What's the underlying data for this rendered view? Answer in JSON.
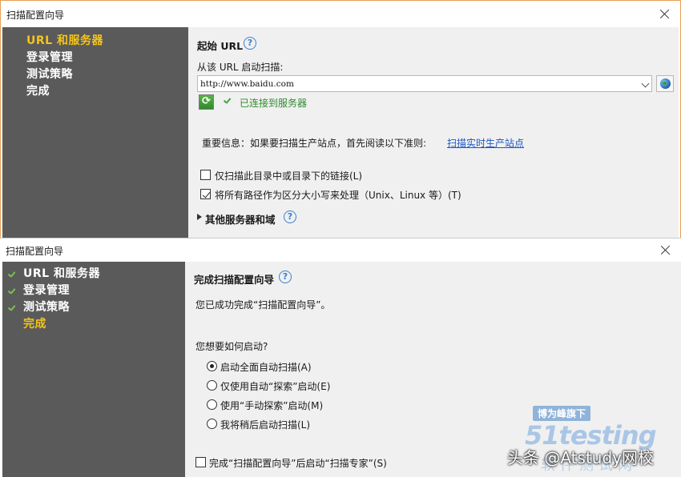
{
  "window1": {
    "title": "扫描配置向导",
    "nav": [
      {
        "label": "URL 和服务器",
        "active": true
      },
      {
        "label": "登录管理",
        "active": false
      },
      {
        "label": "测试策略",
        "active": false
      },
      {
        "label": "完成",
        "active": false
      }
    ],
    "section_title": "起始 URL",
    "help_glyph": "?",
    "field_label": "从该 URL 启动扫描:",
    "url_value": "http://www.baidu.com",
    "refresh_glyph": "⟳",
    "status_text": "已连接到服务器",
    "important_text": "重要信息：如果要扫描生产站点，首先阅读以下准则:",
    "important_link": "扫描实时生产站点",
    "options": [
      {
        "label": "仅扫描此目录中或目录下的链接(L)",
        "checked": false
      },
      {
        "label": "将所有路径作为区分大小写来处理（Unix、Linux 等）(T)",
        "checked": true
      }
    ],
    "expander_label": "其他服务器和域"
  },
  "window2": {
    "title": "扫描配置向导",
    "nav": [
      {
        "label": "URL 和服务器",
        "completed": true,
        "active": false
      },
      {
        "label": "登录管理",
        "completed": true,
        "active": false
      },
      {
        "label": "测试策略",
        "completed": true,
        "active": false
      },
      {
        "label": "完成",
        "completed": false,
        "active": true
      }
    ],
    "section_title": "完成扫描配置向导",
    "help_glyph": "?",
    "done_text": "您已成功完成“扫描配置向导”。",
    "question": "您想要如何启动?",
    "radios": [
      {
        "label": "启动全面自动扫描(A)",
        "checked": true
      },
      {
        "label": "仅使用自动“探索”启动(E)",
        "checked": false
      },
      {
        "label": "使用“手动探索”启动(M)",
        "checked": false
      },
      {
        "label": "我将稍后启动扫描(L)",
        "checked": false
      }
    ],
    "final_checkbox": {
      "label": "完成“扫描配置向导”后启动“扫描专家”(S)",
      "checked": false
    }
  },
  "watermark": {
    "tag": "博为峰旗下",
    "logo": "51testing",
    "sub": "软件测试网",
    "credit": "头条 @Atstudy网校"
  },
  "colors": {
    "sidebar_bg": "#5a5a5a",
    "nav_active": "#f5c518",
    "nav_text": "#ffffff",
    "content_bg": "#f0f0f0",
    "link": "#1c56c4",
    "success": "#2e8b2e",
    "help": "#3b7fd0"
  }
}
